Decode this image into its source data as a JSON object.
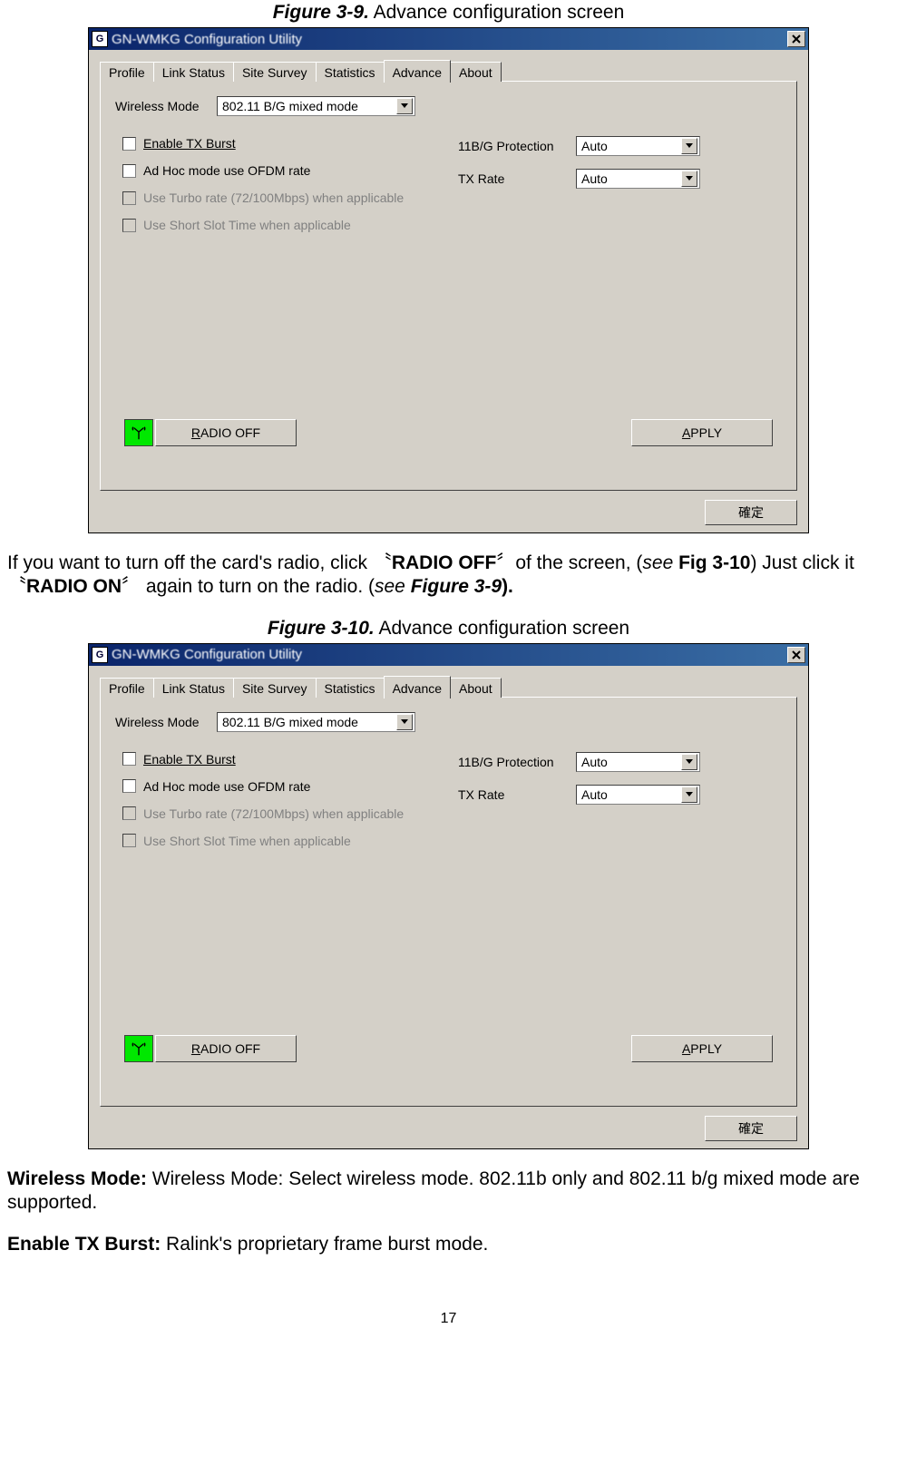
{
  "figures": {
    "f1": {
      "num": "Figure 3-9.",
      "title": "Advance configuration screen"
    },
    "f2": {
      "num": "Figure 3-10.",
      "title": "Advance configuration screen"
    }
  },
  "window": {
    "title": "GN-WMKG Configuration Utility",
    "tabs": [
      "Profile",
      "Link Status",
      "Site Survey",
      "Statistics",
      "Advance",
      "About"
    ],
    "labels": {
      "wireless_mode": "Wireless Mode",
      "protection": "11B/G Protection",
      "txrate": "TX Rate",
      "tx_burst": "Enable TX Burst",
      "adhoc": "Ad Hoc mode use OFDM rate",
      "turbo": "Use Turbo rate (72/100Mbps) when applicable",
      "shortslot": "Use Short Slot Time when applicable"
    },
    "selects": {
      "wireless_mode": "802.11 B/G mixed mode",
      "protection": "Auto",
      "txrate": "Auto"
    },
    "buttons": {
      "radio": "RADIO OFF",
      "apply": "APPLY",
      "ok": "確定"
    }
  },
  "paragraphs": {
    "p1_a": "If you want to turn off the card's radio, click 〝",
    "p1_b": "RADIO OFF",
    "p1_c": "〞of the screen, (",
    "p1_see": "see ",
    "p1_fig": "Fig 3-10",
    "p1_d": ") Just click it〝",
    "p1_e": "RADIO ON",
    "p1_f": "〞 again to turn on the radio. (",
    "p1_see2": "see ",
    "p1_fig2": "Figure 3-9",
    "p1_g": ").",
    "wm_label": "Wireless Mode: ",
    "wm_text": "Wireless Mode: Select wireless mode. 802.11b only and 802.11 b/g mixed mode are supported.",
    "tx_label": "Enable TX Burst: ",
    "tx_text": "Ralink's proprietary frame burst mode."
  },
  "page_number": "17"
}
